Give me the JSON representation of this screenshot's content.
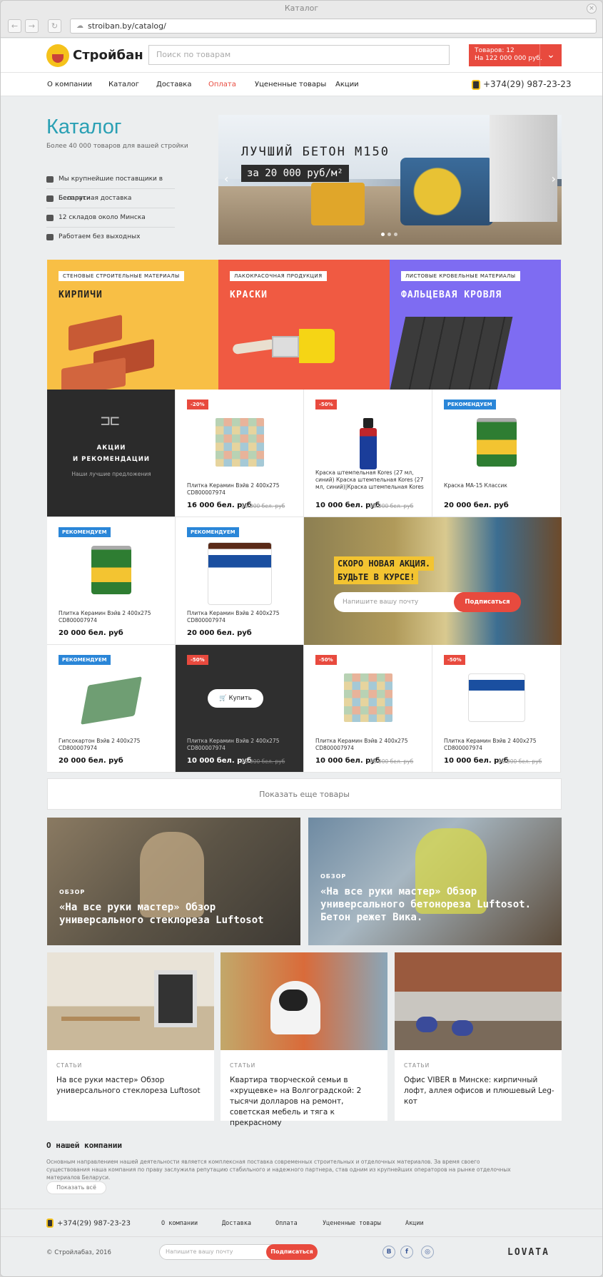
{
  "window": {
    "title": "Каталог",
    "url": "stroiban.by/catalog/"
  },
  "header": {
    "logo_text": "Стройбан",
    "search_placeholder": "Поиск по товарам",
    "cart_line1": "Товаров: 12",
    "cart_line2": "На 122 000 000 руб."
  },
  "menu": {
    "items": [
      "О компании",
      "Каталог",
      "Доставка",
      "Оплата",
      "Уцененные товары",
      "Акции"
    ],
    "active": "Оплата",
    "phone": "+374(29) 987-23-23"
  },
  "catalog": {
    "title": "Каталог",
    "subtitle": "Более 40 000 товаров для вашей стройки",
    "features": [
      "Мы крупнейшие поставщики в Беларуси",
      "Бесплатная доставка",
      "12 складов около Минска",
      "Работаем без выходных"
    ]
  },
  "banner": {
    "title": "ЛУЧШИЙ БЕТОН М150",
    "price": "за 20 000 руб/м²",
    "slides": 3,
    "active_slide": 1
  },
  "categories": [
    {
      "tag": "СТЕНОВЫЕ СТРОИТЕЛЬНЫЕ МАТЕРИАЛЫ",
      "title": "КИРПИЧИ",
      "color": "#f8bf45"
    },
    {
      "tag": "ЛАКОКРАСОЧНАЯ ПРОДУКЦИЯ",
      "title": "КРАСКИ",
      "color": "#f05a42"
    },
    {
      "tag": "ЛИСТОВЫЕ КРОВЕЛЬНЫЕ МАТЕРИАЛЫ",
      "title": "ФАЛЬЦЕВАЯ КРОВЛЯ",
      "color": "#7e6cf2"
    }
  ],
  "promo": {
    "title_line1": "АКЦИИ",
    "title_line2": "И РЕКОМЕНДАЦИИ",
    "subtitle": "Наши лучшие предложения"
  },
  "products": [
    {
      "badge": "-20%",
      "name": "Плитка Керамин Вэйв 2 400х275 CD800007974",
      "price": "16 000 бел. руб",
      "old": "20 000 бел. руб"
    },
    {
      "badge": "-50%",
      "name": "Краска штемпельная Kores (27 мл, синий) Краска штемпельная Kores (27 мл, синий)|Краска штемпельная Kores",
      "price": "10 000 бел. руб",
      "old": "20 000 бел. руб"
    },
    {
      "badge": "РЕКОМЕНДУЕМ",
      "name": "Краска МА-15 Классик",
      "price": "20 000 бел. руб",
      "old": ""
    },
    {
      "badge": "РЕКОМЕНДУЕМ",
      "name": "Плитка Керамин Вэйв 2 400х275 CD800007974",
      "price": "20 000 бел. руб",
      "old": ""
    },
    {
      "badge": "РЕКОМЕНДУЕМ",
      "name": "Плитка Керамин Вэйв 2 400х275 CD800007974",
      "price": "20 000 бел. руб",
      "old": ""
    },
    {
      "badge": "РЕКОМЕНДУЕМ",
      "name": "Гипсокартон Вэйв 2 400х275 CD800007974",
      "price": "20 000 бел. руб",
      "old": ""
    },
    {
      "badge": "-50%",
      "name": "Плитка Керамин Вэйв 2 400х275 CD800007974",
      "price": "10 000 бел. руб",
      "old": "20 000 бел. руб",
      "buy": "Купить"
    },
    {
      "badge": "-50%",
      "name": "Плитка Керамин Вэйв 2 400х275 CD800007974",
      "price": "10 000 бел. руб",
      "old": "20 000 бел. руб"
    },
    {
      "badge": "-50%",
      "name": "Плитка Керамин Вэйв 2 400х275 CD800007974",
      "price": "10 000 бел. руб",
      "old": "20 000 бел. руб"
    }
  ],
  "subscribe": {
    "title_line1": "СКОРО НОВАЯ АКЦИЯ.",
    "title_line2": "БУДЬТЕ В КУРСЕ!",
    "placeholder": "Напишите вашу почту",
    "button": "Подписаться"
  },
  "show_more": "Показать еще товары",
  "reviews": [
    {
      "label": "ОБЗОР",
      "title": "«На все руки мастер» Обзор универсального стеклореза Luftosot"
    },
    {
      "label": "ОБЗОР",
      "title": "«На все руки мастер» Обзор универсального бетонореза Luftosot. Бетон режет Вика."
    }
  ],
  "articles": [
    {
      "cat": "СТАТЬИ",
      "title": "На все руки мастер» Обзор универсального стеклореза Luftosot"
    },
    {
      "cat": "СТАТЬИ",
      "title": "Квартира творческой семьи в «хрущевке» на Волгоградской: 2 тысячи долларов на ремонт, советская мебель и тяга к прекрасному"
    },
    {
      "cat": "СТАТЬИ",
      "title": "Офис VIBER в Минске: кирпичный лофт, аллея офисов и плюшевый Leg-кот"
    }
  ],
  "about": {
    "title": "О нашей компании",
    "text": "Основным направлением нашей деятельности является комплексная поставка современных строительных и отделочных материалов. За время своего существования наша компания по праву заслужила репутацию стабильного и надежного партнера, став одним из крупнейших операторов на рынке отделочных материалов Беларуси.",
    "button": "Показать всё"
  },
  "footer": {
    "phone": "+374(29) 987-23-23",
    "menu": [
      "О компании",
      "Доставка",
      "Оплата",
      "Уцененные товары",
      "Акции"
    ],
    "copyright": "© Стройлабаз, 2016",
    "email_placeholder": "Напишите вашу почту",
    "subscribe": "Подписаться",
    "social": [
      "В",
      "f",
      "◎"
    ],
    "brand": "LOVATA"
  }
}
